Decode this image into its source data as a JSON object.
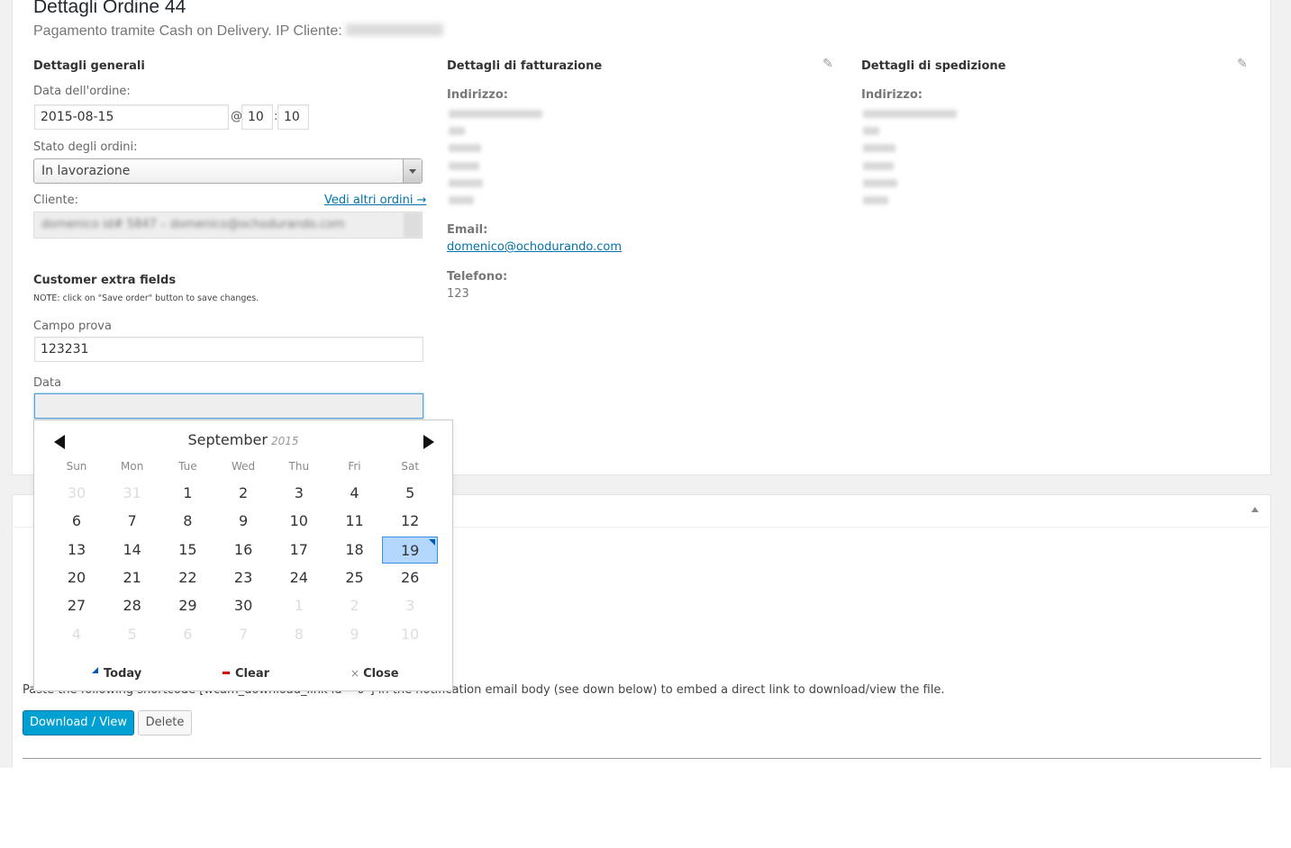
{
  "header": {
    "title": "Dettagli Ordine 44",
    "subtitle": "Pagamento tramite Cash on Delivery. IP Cliente:"
  },
  "general": {
    "heading": "Dettagli generali",
    "date_label": "Data dell'ordine:",
    "date_value": "2015-08-15",
    "at_sep": "@",
    "hour": "10",
    "time_sep": ":",
    "minute": "10",
    "status_label": "Stato degli ordini:",
    "status_value": "In lavorazione",
    "customer_label": "Cliente:",
    "customer_link": "Vedi altri ordini →"
  },
  "billing": {
    "heading": "Dettagli di fatturazione",
    "address_label": "Indirizzo:",
    "email_label": "Email:",
    "email_value": "domenico@ochodurando.com",
    "phone_label": "Telefono:",
    "phone_value": "123"
  },
  "shipping": {
    "heading": "Dettagli di spedizione",
    "address_label": "Indirizzo:"
  },
  "extra": {
    "heading": "Customer extra fields",
    "note": "NOTE: click on \"Save order\" button to save changes.",
    "campo_label": "Campo prova",
    "campo_value": "123231",
    "data_label": "Data"
  },
  "datepicker": {
    "month": "September",
    "year": "2015",
    "weekdays": [
      "Sun",
      "Mon",
      "Tue",
      "Wed",
      "Thu",
      "Fri",
      "Sat"
    ],
    "weeks": [
      [
        "30",
        "31",
        "1",
        "2",
        "3",
        "4",
        "5"
      ],
      [
        "6",
        "7",
        "8",
        "9",
        "10",
        "11",
        "12"
      ],
      [
        "13",
        "14",
        "15",
        "16",
        "17",
        "18",
        "19"
      ],
      [
        "20",
        "21",
        "22",
        "23",
        "24",
        "25",
        "26"
      ],
      [
        "27",
        "28",
        "29",
        "30",
        "1",
        "2",
        "3"
      ],
      [
        "4",
        "5",
        "6",
        "7",
        "8",
        "9",
        "10"
      ]
    ],
    "selected_day": "19",
    "today_label": "Today",
    "clear_label": "Clear",
    "close_label": "Close"
  },
  "attachments": {
    "instruction": "Paste the following shortcode [wcam_download_link id=\"0\"] in the notification email body (see down below) to embed a direct link to download/view the file.",
    "download_label": "Download / View",
    "delete_label": "Delete"
  },
  "icons": {
    "edit": "pencil-icon",
    "collapse": "triangle-up-icon",
    "prev": "left-arrow-icon",
    "next": "right-arrow-icon"
  },
  "colors": {
    "primary_button": "#00a0d2",
    "link": "#0073aa",
    "selected_day": "#b3d7fd"
  }
}
